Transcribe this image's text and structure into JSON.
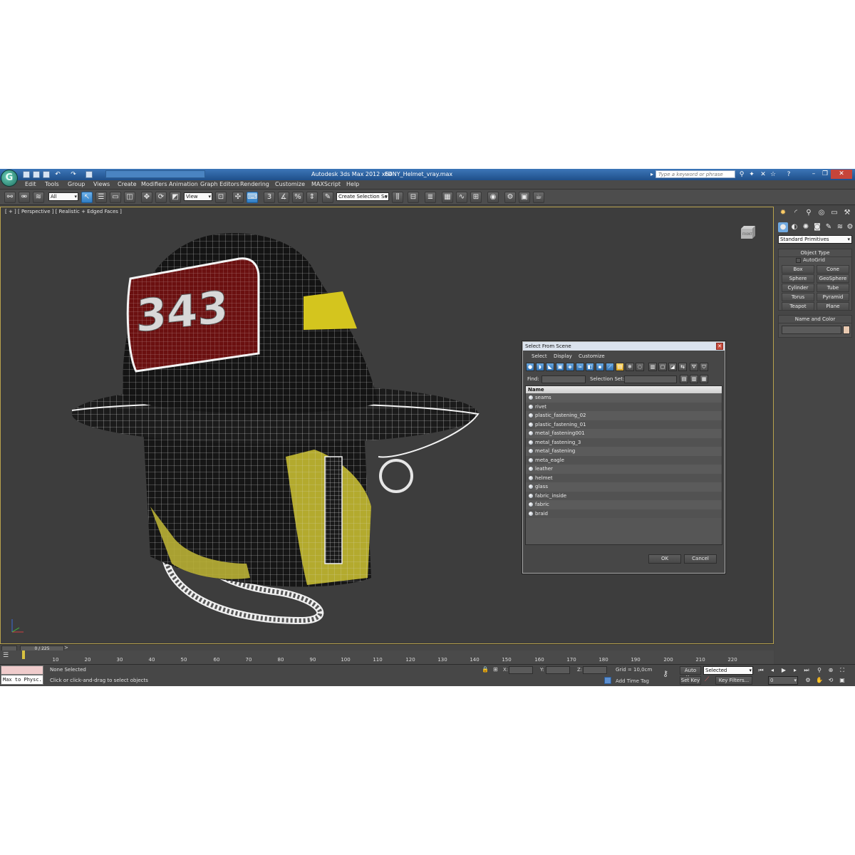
{
  "titlebar": {
    "app_title": "Autodesk 3ds Max  2012 x64",
    "file_name": "FDNY_Helmet_vray.max",
    "search_placeholder": "Type a keyword or phrase"
  },
  "menu": [
    "Edit",
    "Tools",
    "Group",
    "Views",
    "Create",
    "Modifiers",
    "Animation",
    "Graph Editors",
    "Rendering",
    "Customize",
    "MAXScript",
    "Help"
  ],
  "toolbar": {
    "selection_filter": "All",
    "reference_coord": "View",
    "named_selection_placeholder": "Create Selection Se",
    "snap_labels": [
      "3",
      "%"
    ]
  },
  "viewport": {
    "label": "[ + ] [ Perspective ] [ Realistic + Edged Faces ]",
    "viewcube_label": "FRONT",
    "helmet_number": "343"
  },
  "command_panel": {
    "dropdown": "Standard Primitives",
    "object_type_title": "Object Type",
    "autogrid_label": "AutoGrid",
    "primitives": [
      "Box",
      "Cone",
      "Sphere",
      "GeoSphere",
      "Cylinder",
      "Tube",
      "Torus",
      "Pyramid",
      "Teapot",
      "Plane"
    ],
    "name_color_title": "Name and Color"
  },
  "dialog": {
    "title": "Select From Scene",
    "menu": [
      "Select",
      "Display",
      "Customize"
    ],
    "find_label": "Find:",
    "selection_set_label": "Selection Set:",
    "column_name": "Name",
    "objects": [
      "seams",
      "rivet",
      "plastic_fastening_02",
      "plastic_fastening_01",
      "metal_fastening001",
      "metal_fastening_3",
      "metal_fastening",
      "meta_eagle",
      "leather",
      "helmet",
      "glass",
      "fabric_inside",
      "fabric",
      "braid"
    ],
    "ok_label": "OK",
    "cancel_label": "Cancel"
  },
  "timeline": {
    "frame_display": "0 / 225",
    "ticks": [
      "10",
      "20",
      "30",
      "40",
      "50",
      "60",
      "70",
      "80",
      "90",
      "100",
      "110",
      "120",
      "130",
      "140",
      "150",
      "160",
      "170",
      "180",
      "190",
      "200",
      "210",
      "220"
    ]
  },
  "status": {
    "maxscript_text": "Max to Physc.",
    "selection_status": "None Selected",
    "prompt": "Click or click-and-drag to select objects",
    "x_label": "X:",
    "y_label": "Y:",
    "z_label": "Z:",
    "grid": "Grid = 10,0cm",
    "add_time_tag": "Add Time Tag",
    "auto_key": "Auto Key",
    "set_key": "Set Key",
    "key_mode": "Selected",
    "key_filters": "Key Filters...",
    "current_frame": "0"
  }
}
